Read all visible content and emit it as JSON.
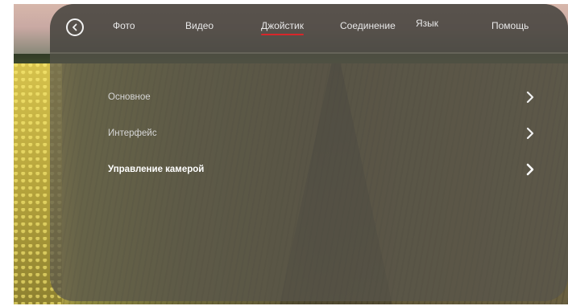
{
  "header": {
    "back_icon": "back-arrow-circle-icon",
    "tabs": [
      {
        "label": "Фото",
        "active": false
      },
      {
        "label": "Видео",
        "active": false
      },
      {
        "label": "Джойстик",
        "active": true
      },
      {
        "label": "Соединение",
        "active": false
      },
      {
        "label": "Язык",
        "active": false
      },
      {
        "label": "Помощь",
        "active": false
      }
    ],
    "active_indicator_color": "#d8262a"
  },
  "menu": {
    "items": [
      {
        "label": "Основное",
        "icon": "chevron-right-icon"
      },
      {
        "label": "Интерфейс",
        "icon": "chevron-right-icon"
      },
      {
        "label": "Управление камерой",
        "icon": "chevron-right-icon"
      }
    ]
  }
}
